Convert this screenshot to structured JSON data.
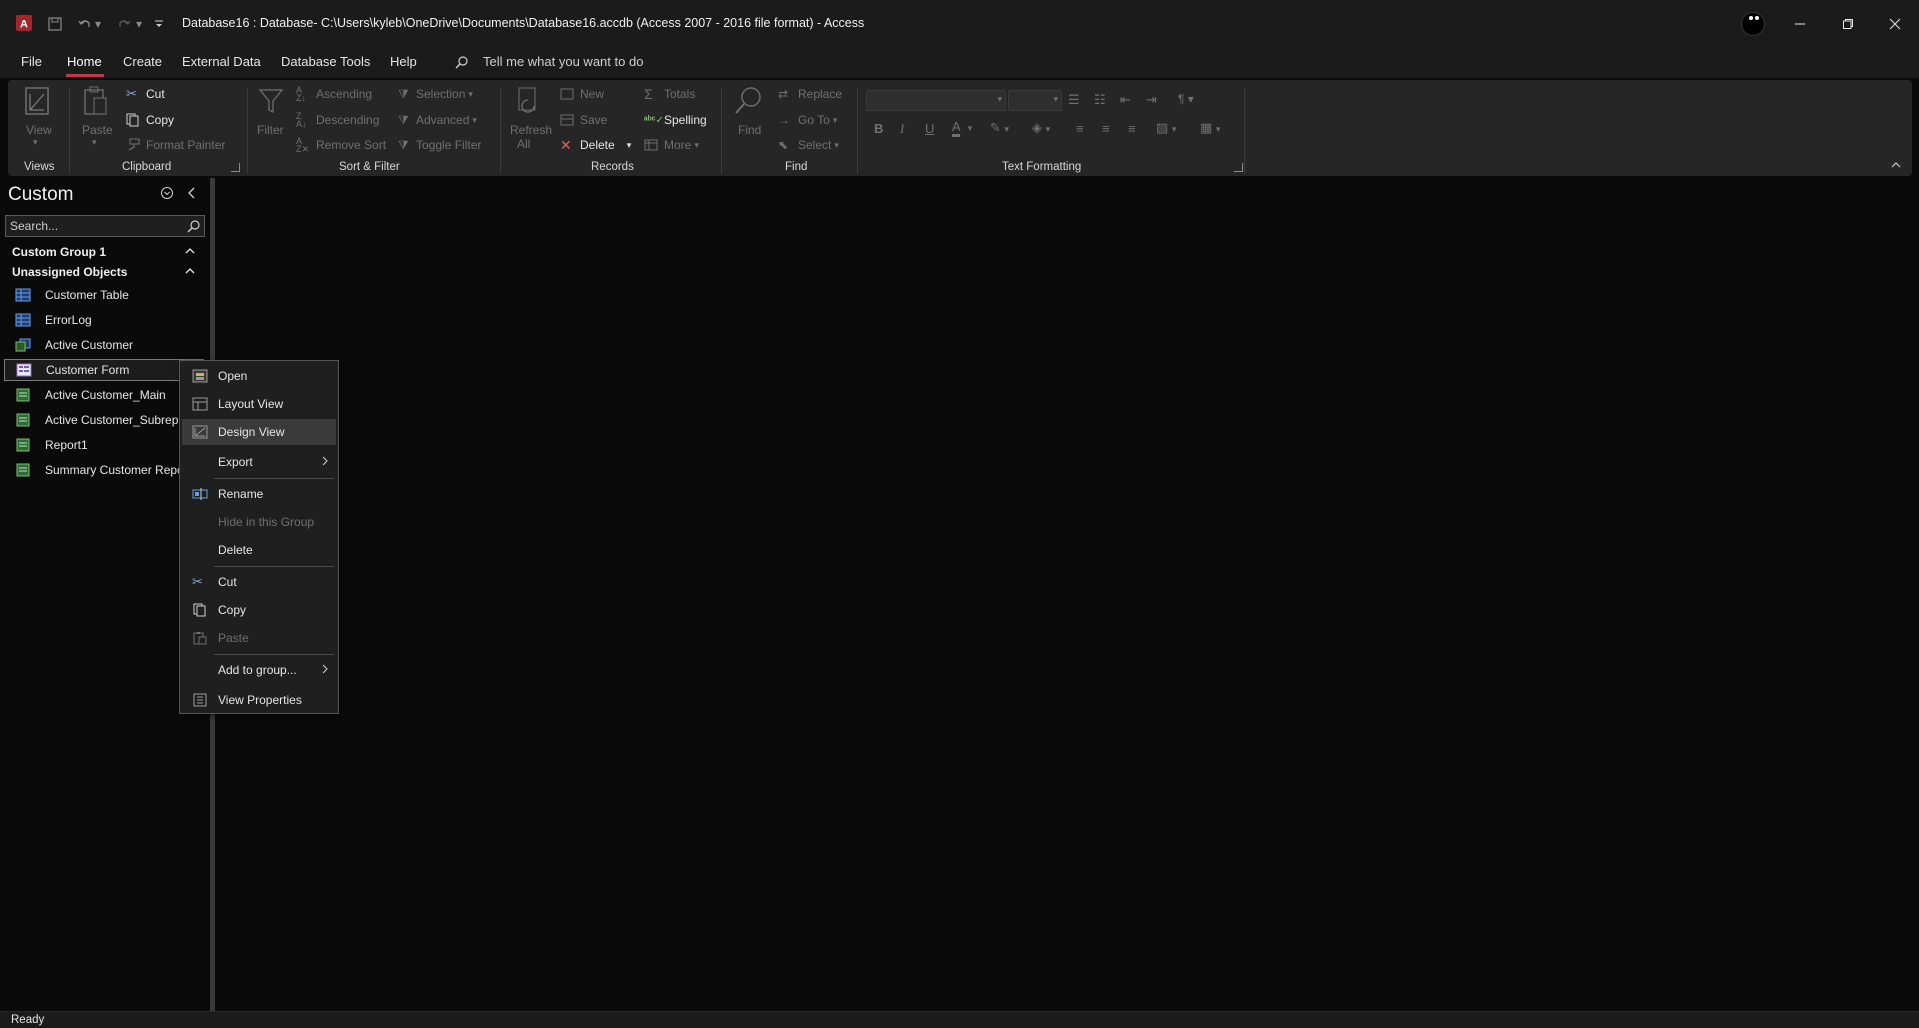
{
  "window": {
    "title": "Database16 : Database- C:\\Users\\kyleb\\OneDrive\\Documents\\Database16.accdb (Access 2007 - 2016 file format)  -  Access"
  },
  "menu": {
    "tabs": [
      "File",
      "Home",
      "Create",
      "External Data",
      "Database Tools",
      "Help"
    ],
    "active": "Home",
    "tell_me": "Tell me what you want to do"
  },
  "ribbon": {
    "views": {
      "view": "View",
      "group": "Views"
    },
    "clipboard": {
      "paste": "Paste",
      "cut": "Cut",
      "copy": "Copy",
      "format_painter": "Format Painter",
      "group": "Clipboard"
    },
    "sort_filter": {
      "filter": "Filter",
      "ascending": "Ascending",
      "descending": "Descending",
      "remove_sort": "Remove Sort",
      "selection": "Selection",
      "advanced": "Advanced",
      "toggle_filter": "Toggle Filter",
      "group": "Sort & Filter"
    },
    "records": {
      "refresh": "Refresh",
      "refresh_sub": "All",
      "new": "New",
      "save": "Save",
      "delete": "Delete",
      "totals": "Totals",
      "spelling": "Spelling",
      "more": "More",
      "group": "Records"
    },
    "find": {
      "find": "Find",
      "replace": "Replace",
      "goto": "Go To",
      "select": "Select",
      "group": "Find"
    },
    "text_formatting": {
      "bold": "B",
      "italic": "I",
      "underline": "U",
      "font_color": "A",
      "group": "Text Formatting"
    }
  },
  "nav": {
    "title": "Custom",
    "search_placeholder": "Search...",
    "groups": [
      "Custom Group 1",
      "Unassigned Objects"
    ],
    "items": [
      {
        "label": "Customer Table",
        "icon": "table-icon"
      },
      {
        "label": "ErrorLog",
        "icon": "table-icon"
      },
      {
        "label": "Active Customer",
        "icon": "query-icon"
      },
      {
        "label": "Customer Form",
        "icon": "form-icon",
        "selected": true
      },
      {
        "label": "Active Customer_Main",
        "icon": "report-icon"
      },
      {
        "label": "Active Customer_Subreport",
        "icon": "report-icon"
      },
      {
        "label": "Report1",
        "icon": "report-icon"
      },
      {
        "label": "Summary Customer Report",
        "icon": "report-icon"
      }
    ]
  },
  "context_menu": {
    "items": [
      {
        "label": "Open",
        "icon": "open-icon"
      },
      {
        "label": "Layout View",
        "icon": "layout-view-icon"
      },
      {
        "label": "Design View",
        "icon": "design-view-icon",
        "hover": true
      },
      {
        "label": "Export",
        "submenu": true
      },
      {
        "label": "Rename",
        "icon": "rename-icon"
      },
      {
        "label": "Hide in this Group",
        "disabled": true
      },
      {
        "label": "Delete"
      },
      {
        "label": "Cut",
        "icon": "cut-icon"
      },
      {
        "label": "Copy",
        "icon": "copy-icon"
      },
      {
        "label": "Paste",
        "icon": "paste-icon",
        "disabled": true
      },
      {
        "label": "Add to group...",
        "submenu": true
      },
      {
        "label": "View Properties",
        "icon": "properties-icon"
      }
    ]
  },
  "status": {
    "text": "Ready"
  },
  "colors": {
    "accent": "#c0394b",
    "background": "#0a0a0a",
    "chrome": "#1b1b1b",
    "ribbon": "#262626"
  }
}
